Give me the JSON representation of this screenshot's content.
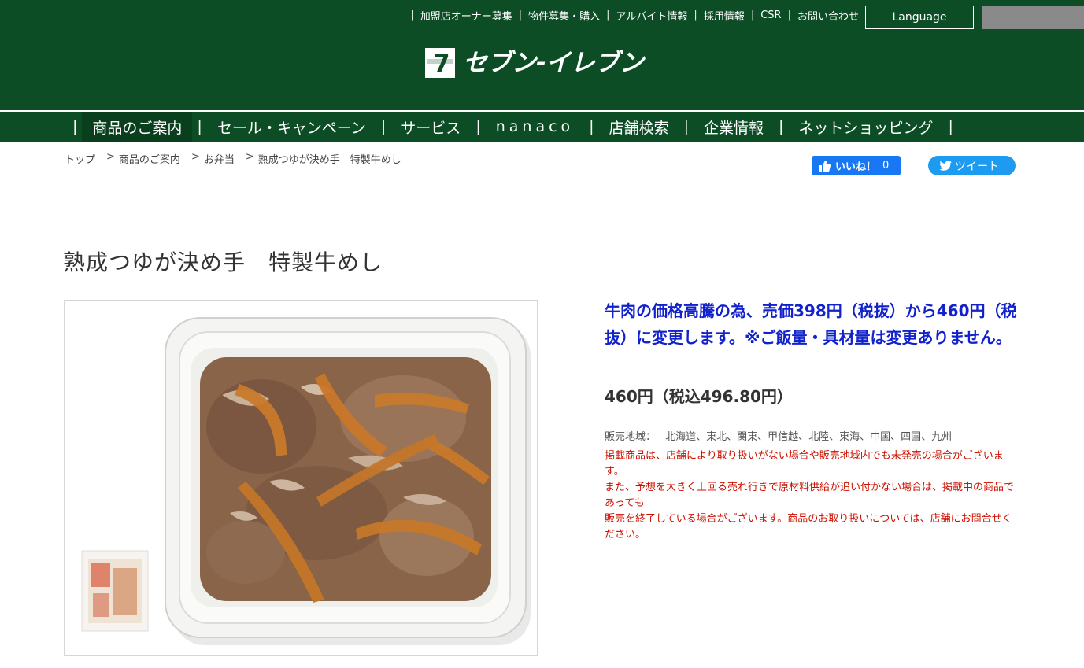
{
  "header": {
    "util_links": [
      "加盟店オーナー募集",
      "物件募集・購入",
      "アルバイト情報",
      "採用情報",
      "CSR",
      "お問い合わせ"
    ],
    "language_button": "Language",
    "logo_text": "セブン-イレブン",
    "colors": {
      "brand_green": "#0c4d25"
    }
  },
  "main_nav": {
    "items": [
      "商品のご案内",
      "セール・キャンペーン",
      "サービス",
      "nanaco",
      "店舗検索",
      "企業情報",
      "ネットショッピング"
    ],
    "active_index": 0
  },
  "breadcrumb": {
    "items": [
      "トップ",
      "商品のご案内",
      "お弁当",
      "熟成つゆが決め手　特製牛めし"
    ]
  },
  "social": {
    "like_label": "いいね！",
    "like_count": "0",
    "tweet_label": "ツイート"
  },
  "product": {
    "title": "熟成つゆが決め手　特製牛めし",
    "notice": "牛肉の価格高騰の為、売価398円（税抜）から460円（税抜）に変更します。※ご飯量・具材量は変更ありません。",
    "price": "460円（税込496.80円）",
    "region_label": "販売地域：",
    "region_value": "北海道、東北、関東、甲信越、北陸、東海、中国、四国、九州",
    "caution_lines": [
      "掲載商品は、店舗により取り扱いがない場合や販売地域内でも未発売の場合がございます。",
      "また、予想を大きく上回る売れ行きで原材料供給が追い付かない場合は、掲載中の商品であっても",
      "販売を終了している場合がございます。商品のお取り扱いについては、店舗にお問合せください。"
    ],
    "colors": {
      "notice": "#1122cc",
      "caution": "#cc1100"
    }
  }
}
